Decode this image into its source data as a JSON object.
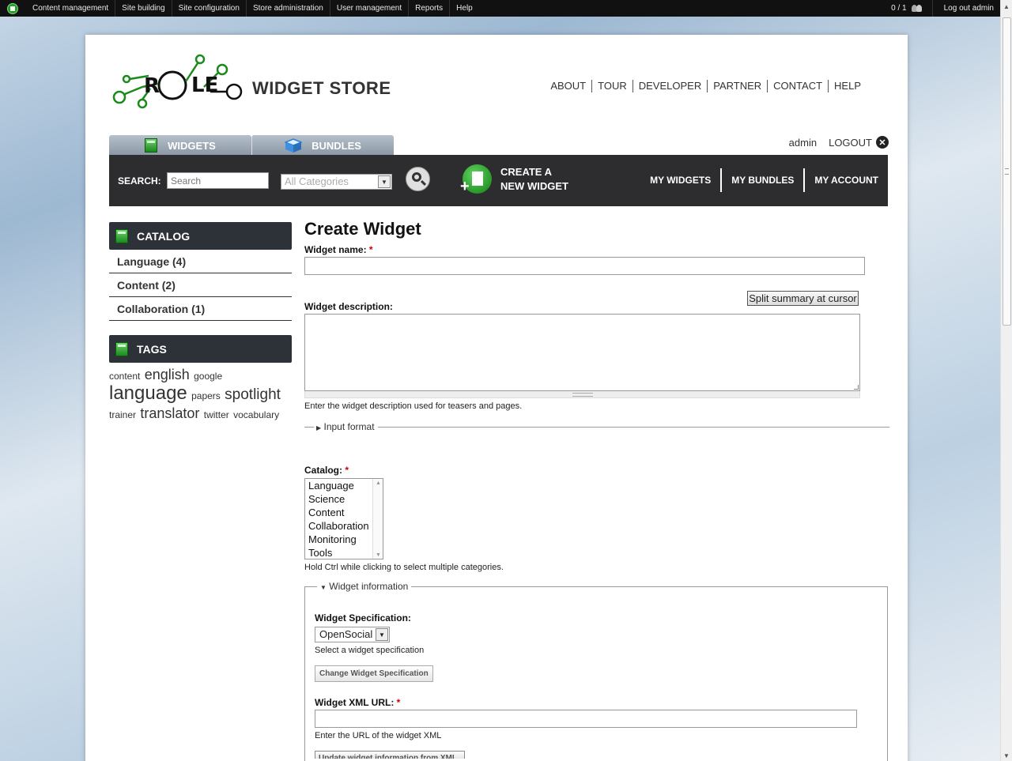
{
  "admin_bar": {
    "menu": [
      "Content management",
      "Site building",
      "Site configuration",
      "Store administration",
      "User management",
      "Reports",
      "Help"
    ],
    "users_count": "0 / 1",
    "logout": "Log out admin"
  },
  "header": {
    "site_title": "WIDGET STORE",
    "nav": [
      "ABOUT",
      "TOUR",
      "DEVELOPER",
      "PARTNER",
      "CONTACT",
      "HELP"
    ],
    "tabs": [
      "WIDGETS",
      "BUNDLES"
    ],
    "user": "admin",
    "logout": "LOGOUT"
  },
  "search": {
    "label": "SEARCH:",
    "placeholder": "Search",
    "category_selected": "All Categories",
    "create_line1": "CREATE A",
    "create_line2": "NEW WIDGET",
    "account_nav": [
      "MY WIDGETS",
      "MY BUNDLES",
      "MY ACCOUNT"
    ]
  },
  "sidebar": {
    "catalog_title": "CATALOG",
    "catalog_items": [
      "Language (4)",
      "Content (2)",
      "Collaboration (1)"
    ],
    "tags_title": "TAGS",
    "tags": [
      "content",
      "english",
      "google",
      "language",
      "papers",
      "spotlight",
      "trainer",
      "translator",
      "twitter",
      "vocabulary"
    ]
  },
  "form": {
    "title": "Create Widget",
    "name_label": "Widget name:",
    "required_mark": "*",
    "split_button": "Split summary at cursor",
    "desc_label": "Widget description:",
    "desc_help": "Enter the widget description used for teasers and pages.",
    "input_format": "Input format",
    "catalog_label": "Catalog:",
    "catalog_options": [
      "Language",
      "Science",
      "Content",
      "Collaboration",
      "Monitoring",
      "Tools"
    ],
    "catalog_help": "Hold Ctrl while clicking to select multiple categories.",
    "widget_info_legend": "Widget information",
    "spec_label": "Widget Specification:",
    "spec_value": "OpenSocial",
    "spec_help": "Select a widget specification",
    "change_spec_button": "Change Widget Specification",
    "xml_label": "Widget XML URL:",
    "xml_help": "Enter the URL of the widget XML",
    "update_button": "Update widget information from XML"
  }
}
